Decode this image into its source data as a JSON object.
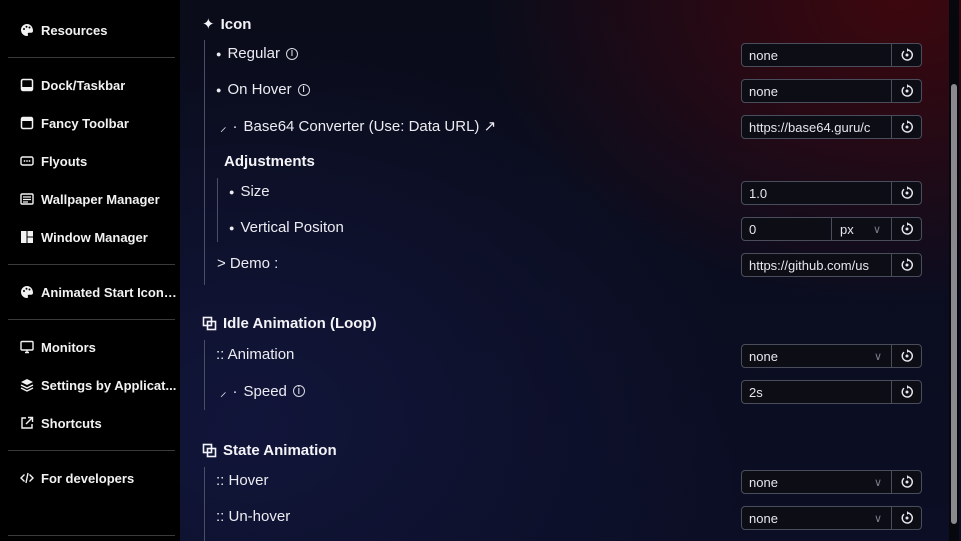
{
  "sidebar": {
    "items": [
      {
        "label": "Resources",
        "icon": "palette-icon"
      },
      {
        "label": "Dock/Taskbar",
        "icon": "taskbar-icon"
      },
      {
        "label": "Fancy Toolbar",
        "icon": "toolbar-icon"
      },
      {
        "label": "Flyouts",
        "icon": "flyout-icon"
      },
      {
        "label": "Wallpaper Manager",
        "icon": "wallpaper-icon"
      },
      {
        "label": "Window Manager",
        "icon": "window-manager-icon"
      },
      {
        "label": "Animated Start Icon ...",
        "icon": "palette-icon"
      },
      {
        "label": "Monitors",
        "icon": "monitor-icon"
      },
      {
        "label": "Settings by Applicat...",
        "icon": "stack-icon"
      },
      {
        "label": "Shortcuts",
        "icon": "external-link-icon"
      },
      {
        "label": "For developers",
        "icon": "code-icon"
      }
    ]
  },
  "icon_section": {
    "title": "Icon",
    "regular": {
      "label": "Regular",
      "value": "none"
    },
    "on_hover": {
      "label": "On Hover",
      "value": "none"
    },
    "base64": {
      "label": "Base64 Converter (Use: Data URL) ↗",
      "value": "https://base64.guru/c"
    },
    "adjustments": {
      "title": "Adjustments"
    },
    "size": {
      "label": "Size",
      "value": "1.0"
    },
    "vertical": {
      "label": "Vertical Positon",
      "value": "0",
      "unit": "px"
    },
    "demo": {
      "label": "> Demo :",
      "value": "https://github.com/us"
    }
  },
  "idle_section": {
    "title": "Idle Animation (Loop)",
    "animation": {
      "label": ":: Animation",
      "value": "none"
    },
    "speed": {
      "label": "Speed",
      "value": "2s"
    }
  },
  "state_section": {
    "title": "State Animation",
    "hover": {
      "label": ":: Hover",
      "value": "none"
    },
    "unhover": {
      "label": ":: Un-hover",
      "value": "none"
    }
  },
  "glyphs": {
    "sparkle": "✦",
    "bullet": "●",
    "curve": "⸝",
    "dot": "·",
    "info": "i",
    "chevron": "∨"
  },
  "colors": {
    "accent_red": "#46060c",
    "sidebar_bg": "#000000",
    "border": "#4a4d5c"
  }
}
